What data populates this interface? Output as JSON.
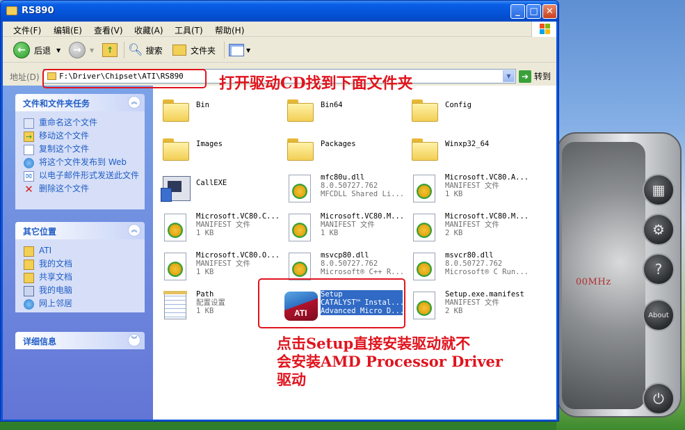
{
  "window": {
    "title": "RS890",
    "min_label": "_",
    "max_label": "□",
    "close_label": "✕"
  },
  "menu": [
    "文件(F)",
    "编辑(E)",
    "查看(V)",
    "收藏(A)",
    "工具(T)",
    "帮助(H)"
  ],
  "toolbar": {
    "back_label": "后退",
    "search_label": "搜索",
    "folders_label": "文件夹"
  },
  "address": {
    "label": "地址(D)",
    "value": "F:\\Driver\\Chipset\\ATI\\RS890",
    "go_label": "转到"
  },
  "sidebar": {
    "tasks": {
      "title": "文件和文件夹任务",
      "items": [
        "重命名这个文件",
        "移动这个文件",
        "复制这个文件",
        "将这个文件发布到 Web",
        "以电子邮件形式发送此文件",
        "删除这个文件"
      ]
    },
    "places": {
      "title": "其它位置",
      "items": [
        "ATI",
        "我的文档",
        "共享文档",
        "我的电脑",
        "网上邻居"
      ]
    },
    "details": {
      "title": "详细信息"
    }
  },
  "files": [
    {
      "name": "Bin",
      "type": "folder"
    },
    {
      "name": "Bin64",
      "type": "folder"
    },
    {
      "name": "Config",
      "type": "folder"
    },
    {
      "name": "Images",
      "type": "folder"
    },
    {
      "name": "Packages",
      "type": "folder"
    },
    {
      "name": "Winxp32_64",
      "type": "folder"
    },
    {
      "name": "CallEXE",
      "type": "exe"
    },
    {
      "name": "mfc80u.dll",
      "line2": "8.0.50727.762",
      "line3": "MFCDLL Shared Li...",
      "type": "gear"
    },
    {
      "name": "Microsoft.VC80.A...",
      "line2": "MANIFEST 文件",
      "line3": "1 KB",
      "type": "gear"
    },
    {
      "name": "Microsoft.VC80.C...",
      "line2": "MANIFEST 文件",
      "line3": "1 KB",
      "type": "gear"
    },
    {
      "name": "Microsoft.VC80.M...",
      "line2": "MANIFEST 文件",
      "line3": "1 KB",
      "type": "gear"
    },
    {
      "name": "Microsoft.VC80.M...",
      "line2": "MANIFEST 文件",
      "line3": "2 KB",
      "type": "gear"
    },
    {
      "name": "Microsoft.VC80.O...",
      "line2": "MANIFEST 文件",
      "line3": "1 KB",
      "type": "gear"
    },
    {
      "name": "msvcp80.dll",
      "line2": "8.0.50727.762",
      "line3": "Microsoft® C++ R...",
      "type": "gear"
    },
    {
      "name": "msvcr80.dll",
      "line2": "8.0.50727.762",
      "line3": "Microsoft® C Run...",
      "type": "gear"
    },
    {
      "name": "Path",
      "line2": "配置设置",
      "line3": "1 KB",
      "type": "notepad"
    },
    {
      "name": "Setup",
      "line2": "CATALYST™ Instal...",
      "line3": "Advanced Micro D...",
      "type": "ati",
      "selected": true
    },
    {
      "name": "Setup.exe.manifest",
      "line2": "MANIFEST 文件",
      "line3": "2 KB",
      "type": "gear"
    }
  ],
  "annotations": {
    "top": "打开驱动CD找到下面文件夹",
    "bottom_line1": "点击Setup直接安装驱动就不",
    "bottom_line2": "会安装AMD Processor Driver",
    "bottom_line3": "驱动"
  },
  "gadget": {
    "mhz_text": "00MHz",
    "about_label": "About"
  },
  "colors": {
    "title_blue": "#0553d7",
    "annotation_red": "#e0141e",
    "task_link": "#215dc6",
    "selection": "#316ac5"
  }
}
